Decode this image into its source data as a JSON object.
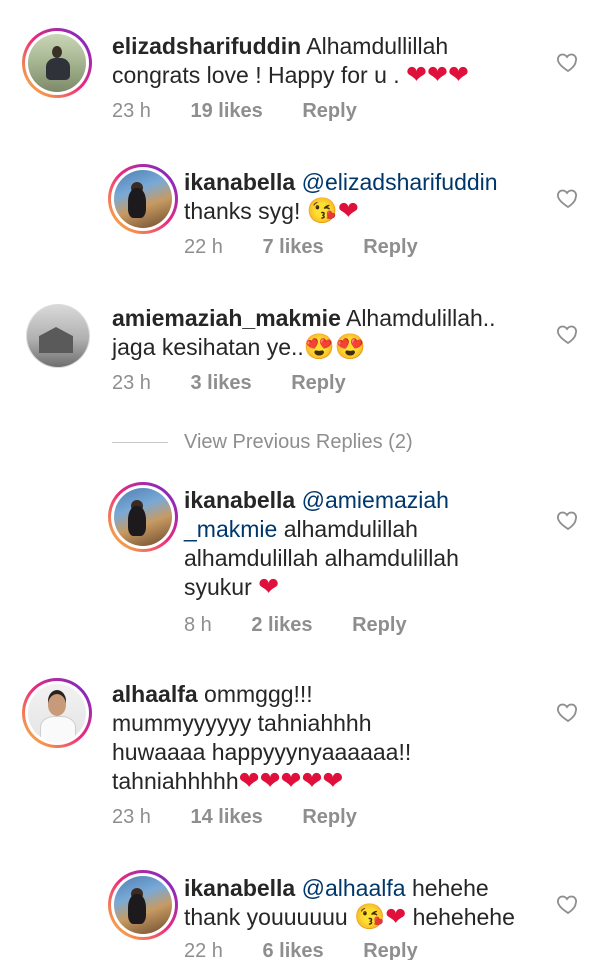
{
  "comments": [
    {
      "username": "elizadsharifuddin",
      "text_line1": "Alhamdullillah",
      "text_line2": "congrats love ! Happy for u .",
      "emoji": "❤❤❤",
      "time": "23 h",
      "likes": "19 likes",
      "reply": "Reply"
    },
    {
      "username": "ikanabella",
      "mention": "@elizadsharifuddin",
      "text_line2": "thanks syg!",
      "emoji": "😘❤",
      "time": "22 h",
      "likes": "7 likes",
      "reply": "Reply"
    },
    {
      "username": "amiemaziah_makmie",
      "text_line1": "Alhamdulillah..",
      "text_line2": "jaga kesihatan ye..",
      "emoji": "😍😍",
      "time": "23 h",
      "likes": "3 likes",
      "reply": "Reply"
    },
    {
      "username": "ikanabella",
      "mention_part1": "@amiemaziah",
      "mention_part2": "_makmie",
      "text_line2": "alhamdulillah",
      "text_line3": "alhamdulillah alhamdulillah",
      "text_line4": "syukur",
      "emoji": "❤",
      "time": "8 h",
      "likes": "2 likes",
      "reply": "Reply"
    },
    {
      "username": "alhaalfa",
      "text_line1": "ommggg!!!",
      "text_line2": "mummyyyyyy tahniahhhh",
      "text_line3": "huwaaaa happyyynyaaaaaa!!",
      "text_line4": "tahniahhhhh",
      "emoji": "❤❤❤❤❤",
      "time": "23 h",
      "likes": "14 likes",
      "reply": "Reply"
    },
    {
      "username": "ikanabella",
      "mention": "@alhaalfa",
      "text_line1": "hehehe",
      "text_line2": "thank youuuuuu",
      "emoji": "😘❤",
      "text_line2_end": "hehehehe",
      "time": "22 h",
      "likes": "6 likes",
      "reply": "Reply"
    }
  ],
  "view_previous_replies": "View Previous Replies (2)",
  "colors": {
    "text": "#262626",
    "secondary": "#8e8e8e",
    "mention": "#00376b",
    "heart": "#e0103c"
  },
  "icons": {
    "like": "heart-outline-icon"
  }
}
